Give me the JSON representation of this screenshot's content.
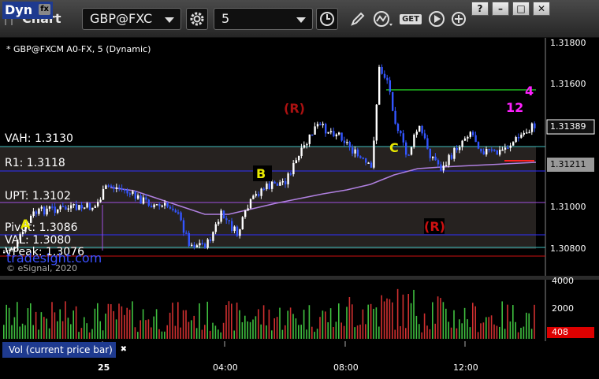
{
  "toolbar": {
    "title": "Chart",
    "symbol": "GBP@FXC",
    "interval": "5",
    "get_label": "GET",
    "window_buttons": [
      "?",
      "–",
      "□",
      "✕"
    ]
  },
  "chart": {
    "series_label": "* GBP@FXCM A0-FX, 5 (Dynamic)",
    "price_axis": [
      "1.31800",
      "1.31600",
      "1.31400",
      "1.31200",
      "1.31000",
      "1.30800"
    ],
    "last_price": "1.31389",
    "second_price": "1.31211",
    "levels": {
      "vah": "VAH: 1.3130",
      "r1": "R1: 1.3118",
      "upt": "UPT: 1.3102",
      "pivot": "Pivot: 1.3086",
      "val": "VAL: 1.3080",
      "vpeak": "VPeak: 1.3076"
    },
    "markers": {
      "a": "A",
      "b": "B",
      "c": "C",
      "r_top": "(R)",
      "r_bottom": "(R)",
      "count_12": "12",
      "count_4": "4"
    },
    "watermark": "tradesight.com",
    "copyright": "© eSignal, 2020"
  },
  "volume": {
    "axis": [
      "4000",
      "2000"
    ],
    "last_value": "408",
    "label": "Vol (current price bar)",
    "close": "✖"
  },
  "time_axis": [
    "25",
    "04:00",
    "08:00",
    "12:00"
  ],
  "status": {
    "dyn": "Dyn",
    "fx": "fx"
  },
  "colors": {
    "bull_candle": "#ffffff",
    "bear_candle": "#3355ff",
    "vah_val_line": "#40c0c0",
    "pivot_line": "#2a2aff",
    "upt_line": "#a050e0",
    "ma_line": "#b080e0",
    "r_marker": "#cc1111",
    "last_price_bg": "#111",
    "volume_tag": "#dd0000"
  }
}
